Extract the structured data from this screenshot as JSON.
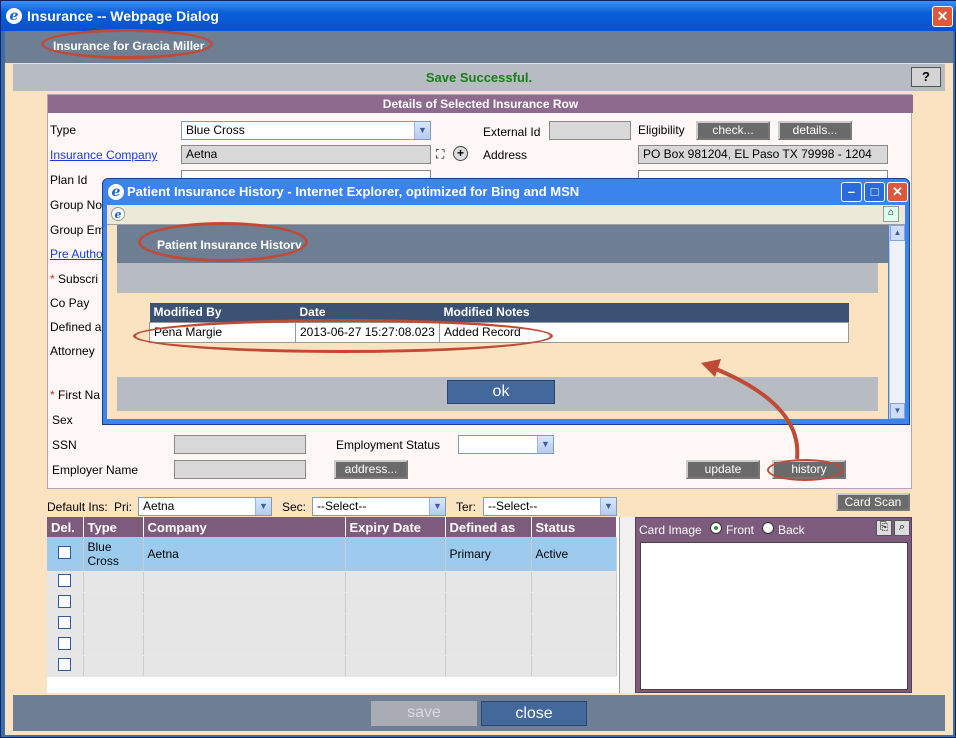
{
  "window": {
    "title": "Insurance -- Webpage Dialog",
    "close": "✕"
  },
  "header": {
    "title": "Insurance for Gracia Miller"
  },
  "status": {
    "message": "Save Successful.",
    "help": "?"
  },
  "details": {
    "heading": "Details of Selected Insurance Row",
    "type_label": "Type",
    "type_value": "Blue Cross",
    "external_id_label": "External Id",
    "external_id_value": "",
    "eligibility_label": "Eligibility",
    "check_button": "check...",
    "details_button": "details...",
    "company_label": "Insurance Company",
    "company_value": "Aetna",
    "address_label": "Address",
    "address_value": "PO Box 981204, EL Paso TX 79998 - 1204",
    "plan_id_label": "Plan Id",
    "group_no_label": "Group No",
    "group_emp_label": "Group Em",
    "pre_auth_label": "Pre Autho",
    "subscriber_label": "Subscri",
    "copay_label": "Co Pay",
    "defined_label": "Defined a",
    "attorney_label": "Attorney",
    "first_name_label": "First Na",
    "sex_label": "Sex",
    "ssn_label": "SSN",
    "employment_status_label": "Employment Status",
    "employer_name_label": "Employer Name",
    "address_button": "address...",
    "update_button": "update",
    "history_button": "history"
  },
  "popup": {
    "title": "Patient Insurance History - Internet Explorer, optimized for Bing and MSN",
    "header": "Patient Insurance History",
    "columns": [
      "Modified By",
      "Date",
      "Modified Notes"
    ],
    "rows": [
      [
        "Pena Margie",
        "2013-06-27 15:27:08.023",
        "Added Record"
      ]
    ],
    "ok_button": "ok"
  },
  "defaults": {
    "label": "Default Ins:",
    "pri_label": "Pri:",
    "pri_value": "Aetna",
    "sec_label": "Sec:",
    "sec_value": "--Select--",
    "ter_label": "Ter:",
    "ter_value": "--Select--",
    "card_scan_button": "Card Scan"
  },
  "grid": {
    "columns": [
      "Del.",
      "Type",
      "Company",
      "Expiry Date",
      "Defined as",
      "Status"
    ],
    "rows": [
      {
        "type": "Blue Cross",
        "company": "Aetna",
        "expiry": "",
        "defined": "Primary",
        "status": "Active"
      }
    ]
  },
  "card": {
    "label": "Card Image",
    "front": "Front",
    "back": "Back"
  },
  "footer": {
    "save": "save",
    "close": "close"
  },
  "colors": {
    "accent_purple": "#7d5b7d",
    "title_blue": "#0a5fd8",
    "annotation_red": "#c04a36"
  }
}
